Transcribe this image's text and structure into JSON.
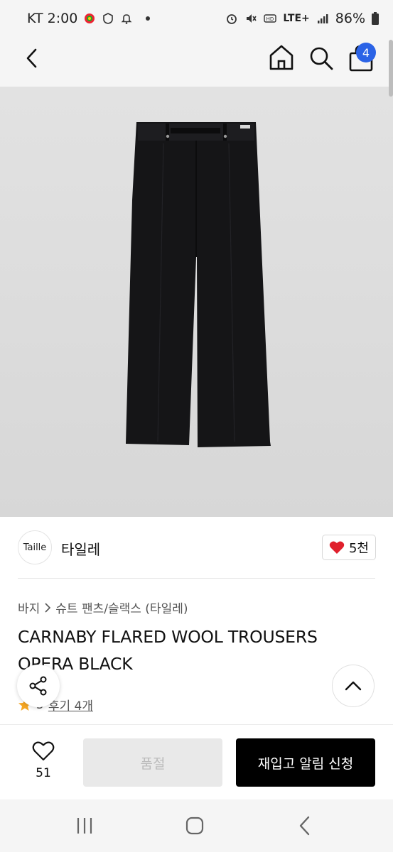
{
  "status": {
    "carrier_time": "KT 2:00",
    "network": "LTE+",
    "battery": "86%"
  },
  "header": {
    "cart_count": "4"
  },
  "brand": {
    "logo_text": "Taille",
    "name": "타일레",
    "likes": "5천"
  },
  "breadcrumb": {
    "category": "바지",
    "subcategory": "슈트 팬츠/슬랙스 (타일레)"
  },
  "product": {
    "title": "CARNABY FLARED WOOL TROUSERS OPERA BLACK",
    "rating": "5",
    "reviews": "후기 4개"
  },
  "actions": {
    "wish_count": "51",
    "soldout_label": "품절",
    "restock_label": "재입고 알림 신청"
  },
  "colors": {
    "accent": "#2b63e6",
    "heart": "#e0202c",
    "star": "#f5a623"
  }
}
